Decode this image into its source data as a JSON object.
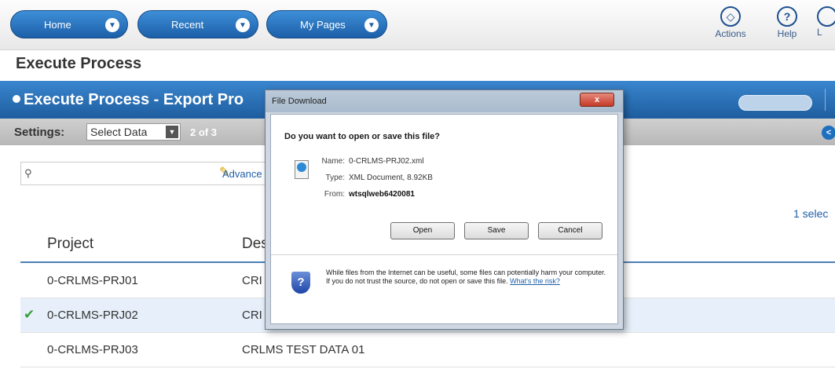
{
  "nav": {
    "buttons": [
      {
        "label": "Home"
      },
      {
        "label": "Recent"
      },
      {
        "label": "My Pages"
      }
    ],
    "tools": [
      {
        "label": "Actions",
        "icon": "actions-icon"
      },
      {
        "label": "Help",
        "icon": "help-icon"
      },
      {
        "label": "L",
        "icon": "logout-icon"
      }
    ]
  },
  "page": {
    "title": "Execute Process"
  },
  "panel": {
    "title": "Execute Process - Export Pro"
  },
  "settings": {
    "label": "Settings:",
    "select_value": "Select Data",
    "count": "2 of 3"
  },
  "search": {
    "placeholder": "",
    "advanced_label": "Advance"
  },
  "selection": {
    "text": "1 selec"
  },
  "table": {
    "headers": [
      "Project",
      "Des"
    ],
    "rows": [
      {
        "project": "0-CRLMS-PRJ01",
        "desc": "CRI",
        "selected": false
      },
      {
        "project": "0-CRLMS-PRJ02",
        "desc": "CRI",
        "selected": true
      },
      {
        "project": "0-CRLMS-PRJ03",
        "desc": "CRLMS TEST DATA 01",
        "selected": false
      }
    ]
  },
  "dialog": {
    "title": "File Download",
    "close_label": "x",
    "question": "Do you want to open or save this file?",
    "name_label": "Name:",
    "name": "0-CRLMS-PRJ02.xml",
    "type_label": "Type:",
    "type": "XML Document, 8.92KB",
    "from_label": "From:",
    "from": "wtsqlweb6420081",
    "buttons": {
      "open": "Open",
      "save": "Save",
      "cancel": "Cancel"
    },
    "warning": "While files from the Internet can be useful, some files can potentially harm your computer. If you do not trust the source, do not open or save this file.",
    "risk_link": "What's the risk?"
  },
  "colors": {
    "accent": "#1e5d9f",
    "link": "#1f5fa8",
    "check": "#3aa03a"
  }
}
